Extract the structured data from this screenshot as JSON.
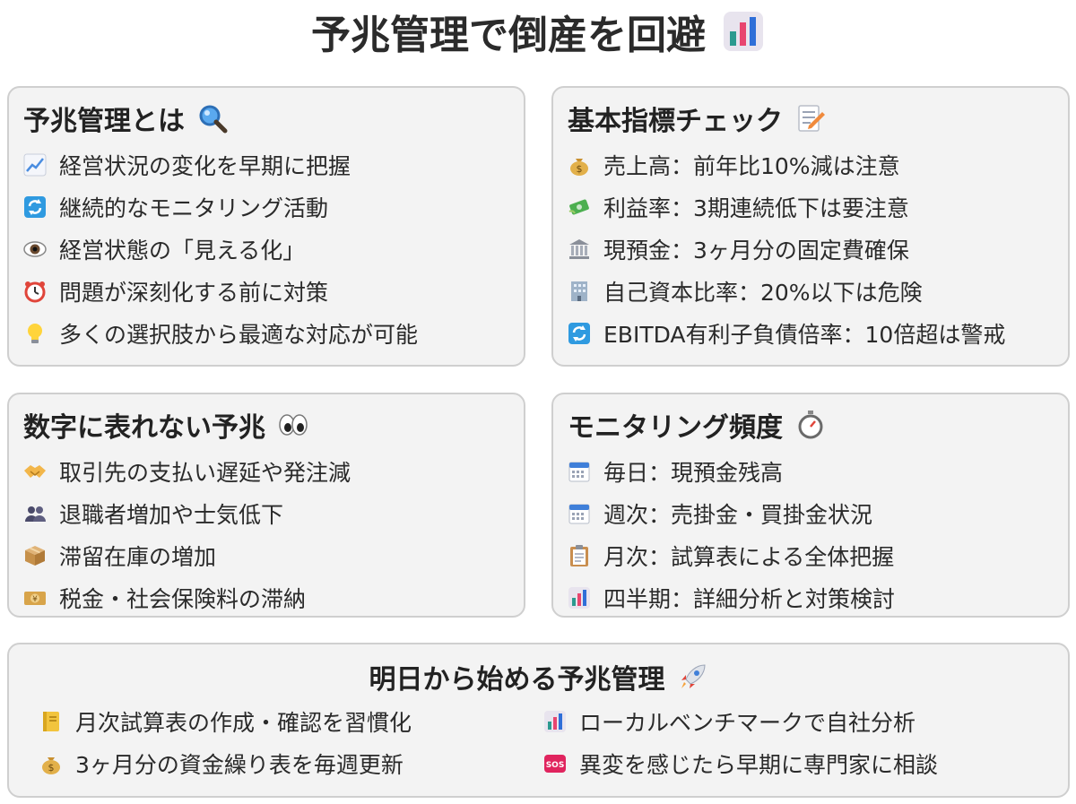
{
  "title": "予兆管理で倒産を回避",
  "title_icon": "bar-chart-icon",
  "cards": [
    {
      "heading": "予兆管理とは",
      "heading_icon": "magnifier-icon",
      "items": [
        {
          "icon": "chart-up-icon",
          "text": "経営状況の変化を早期に把握"
        },
        {
          "icon": "repeat-icon",
          "text": "継続的なモニタリング活動"
        },
        {
          "icon": "eye-icon",
          "text": "経営状態の「見える化」"
        },
        {
          "icon": "alarm-clock-icon",
          "text": "問題が深刻化する前に対策"
        },
        {
          "icon": "light-bulb-icon",
          "text": "多くの選択肢から最適な対応が可能"
        }
      ]
    },
    {
      "heading": "基本指標チェック",
      "heading_icon": "memo-icon",
      "items": [
        {
          "icon": "money-bag-icon",
          "text": "売上高：前年比10%減は注意"
        },
        {
          "icon": "money-wings-icon",
          "text": "利益率：3期連続低下は要注意"
        },
        {
          "icon": "bank-icon",
          "text": "現預金：3ヶ月分の固定費確保"
        },
        {
          "icon": "office-building-icon",
          "text": "自己資本比率：20%以下は危険"
        },
        {
          "icon": "repeat-icon",
          "text": "EBITDA有利子負債倍率：10倍超は警戒"
        }
      ]
    },
    {
      "heading": "数字に表れない予兆",
      "heading_icon": "eyes-icon",
      "items": [
        {
          "icon": "handshake-icon",
          "text": "取引先の支払い遅延や発注減"
        },
        {
          "icon": "people-icon",
          "text": "退職者増加や士気低下"
        },
        {
          "icon": "package-icon",
          "text": "滞留在庫の増加"
        },
        {
          "icon": "yen-banknote-icon",
          "text": "税金・社会保険料の滞納"
        }
      ]
    },
    {
      "heading": "モニタリング頻度",
      "heading_icon": "stopwatch-icon",
      "items": [
        {
          "icon": "calendar-icon",
          "text": "毎日：現預金残高"
        },
        {
          "icon": "calendar-icon",
          "text": "週次：売掛金・買掛金状況"
        },
        {
          "icon": "clipboard-icon",
          "text": "月次：試算表による全体把握"
        },
        {
          "icon": "bar-chart-icon",
          "text": "四半期：詳細分析と対策検討"
        }
      ]
    }
  ],
  "action": {
    "heading": "明日から始める予兆管理",
    "heading_icon": "rocket-icon",
    "left": [
      {
        "icon": "ledger-icon",
        "text": "月次試算表の作成・確認を習慣化"
      },
      {
        "icon": "money-bag-icon",
        "text": "3ヶ月分の資金繰り表を毎週更新"
      }
    ],
    "right": [
      {
        "icon": "bar-chart-icon",
        "text": "ローカルベンチマークで自社分析"
      },
      {
        "icon": "sos-icon",
        "text": "異変を感じたら早期に専門家に相談"
      }
    ]
  }
}
